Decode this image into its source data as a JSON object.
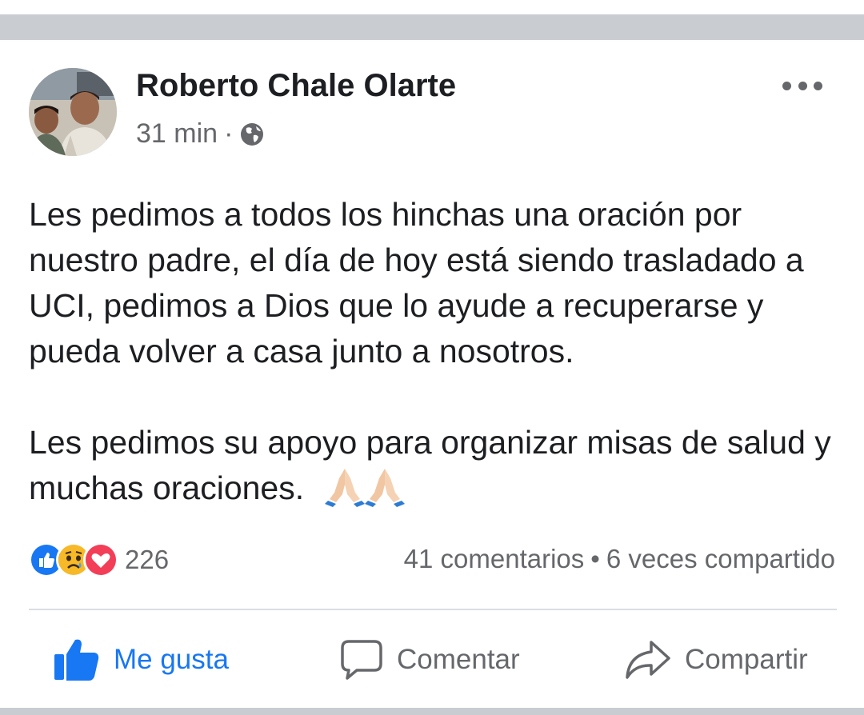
{
  "post": {
    "author": "Roberto Chale Olarte",
    "time": "31 min",
    "separator": "·",
    "privacy_icon": "globe-icon",
    "paragraph1": "Les pedimos a todos los hinchas una oración por nuestro padre, el día de hoy está siendo trasladado a UCI, pedimos a Dios que lo ayude a recuperarse y pueda volver a casa junto a nosotros.",
    "paragraph2": "Les pedimos su apoyo para organizar misas de salud y muchas oraciones.",
    "emoji": [
      "praying-hands",
      "praying-hands"
    ]
  },
  "engagement": {
    "reactions": [
      "like",
      "sad",
      "love"
    ],
    "reaction_count": "226",
    "comments": "41 comentarios",
    "bullet": "•",
    "shares": "6 veces compartido"
  },
  "actions": {
    "like": "Me gusta",
    "comment": "Comentar",
    "share": "Compartir"
  },
  "colors": {
    "accent": "#1877f2",
    "text": "#1c1e21",
    "secondary": "#65676b",
    "love": "#f33e58",
    "sad": "#f7b928"
  }
}
